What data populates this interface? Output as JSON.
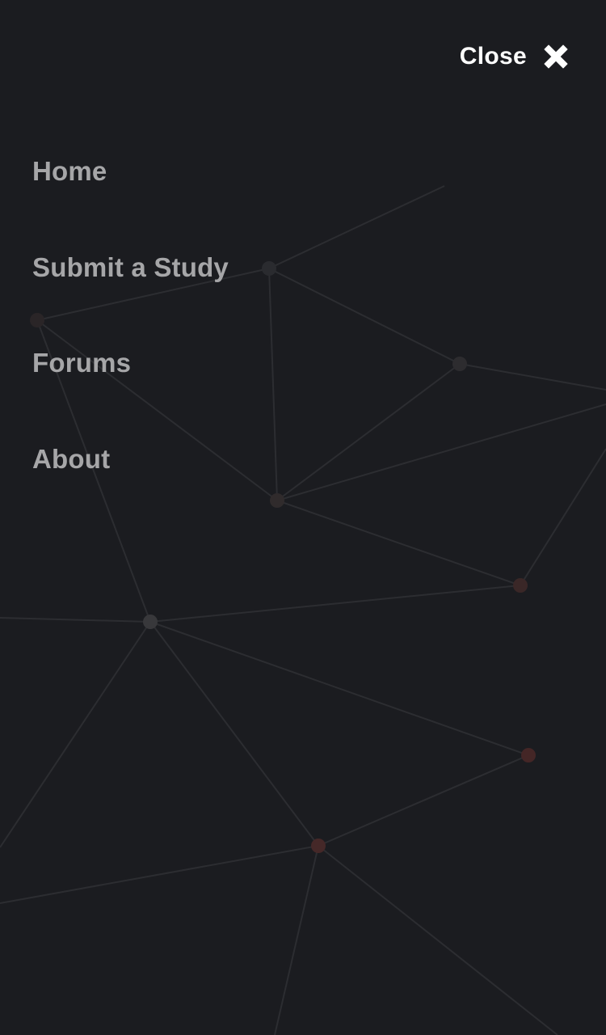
{
  "close": {
    "label": "Close",
    "icon": "close-icon"
  },
  "nav": {
    "items": [
      {
        "label": "Home"
      },
      {
        "label": "Submit a Study"
      },
      {
        "label": "Forums"
      },
      {
        "label": "About"
      }
    ]
  },
  "colors": {
    "background": "#1b1c20",
    "nav_text": "#a6a6a8",
    "close_text": "#ffffff",
    "network_line": "#2c2d31",
    "network_node_grey": "#3a3a3c",
    "network_node_red": "#4a2a2a"
  }
}
